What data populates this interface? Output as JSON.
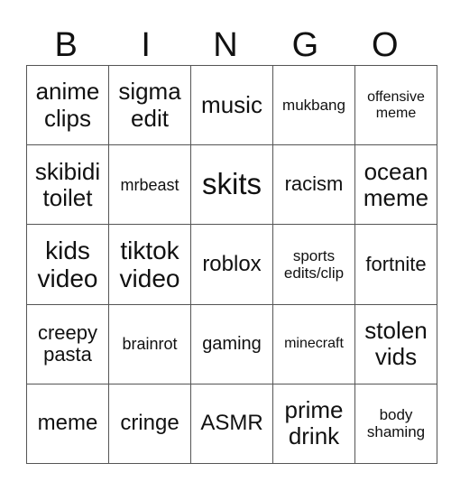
{
  "header": [
    "B",
    "I",
    "N",
    "G",
    "O"
  ],
  "cells": [
    [
      "anime clips",
      "sigma edit",
      "music",
      "mukbang",
      "offensive meme"
    ],
    [
      "skibidi toilet",
      "mrbeast",
      "skits",
      "racism",
      "ocean meme"
    ],
    [
      "kids video",
      "tiktok video",
      "roblox",
      "sports edits/clip",
      "fortnite"
    ],
    [
      "creepy pasta",
      "brainrot",
      "gaming",
      "minecraft",
      "stolen vids"
    ],
    [
      "meme",
      "cringe",
      "ASMR",
      "prime drink",
      "body shaming"
    ]
  ]
}
